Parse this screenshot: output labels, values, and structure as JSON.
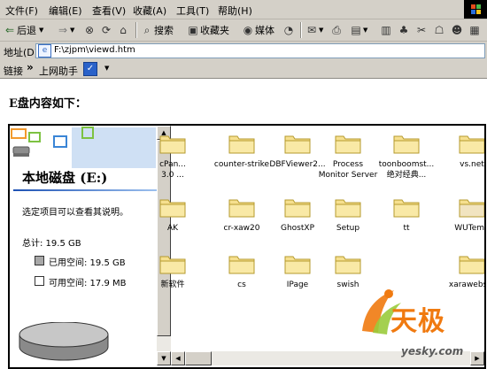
{
  "menu": [
    "文件(F)",
    "编辑(E)",
    "查看(V)",
    "收藏(A)",
    "工具(T)",
    "帮助(H)"
  ],
  "toolbar": {
    "back": "后退",
    "search": "搜索",
    "favorites": "收藏夹",
    "media": "媒体"
  },
  "address": {
    "label": "地址(D)",
    "url": "F:\\zjpm\\viewd.htm"
  },
  "links": {
    "label": "链接",
    "chevron": "»",
    "helper": "上网助手"
  },
  "page": {
    "heading": "E盘内容如下："
  },
  "drive": {
    "title": "本地磁盘 (E:)",
    "hint": "选定项目可以查看其说明。",
    "total": "总计: 19.5 GB",
    "used": "已用空间: 19.5 GB",
    "free": "可用空间: 17.9 MB"
  },
  "folders": [
    [
      "cPan...\n3.0 ...",
      "counter-strike",
      "DBFViewer2...",
      "Process\nMonitor Server",
      "toonboomst...\n绝对经典...",
      "vs.net"
    ],
    [
      "AK",
      "cr-xaw20",
      "GhostXP",
      "Setup",
      "tt",
      "WUTemp"
    ],
    [
      "新软件",
      "cs",
      "IPage",
      "swish",
      "",
      "xarawebsty"
    ]
  ],
  "watermark": {
    "brand": "天极",
    "site": "yesky.com"
  },
  "colors": {
    "chrome": "#d4d0c8",
    "folder": "#f6e08f",
    "title_blue": "#1e52b4",
    "accent_orange": "#f07a10"
  }
}
